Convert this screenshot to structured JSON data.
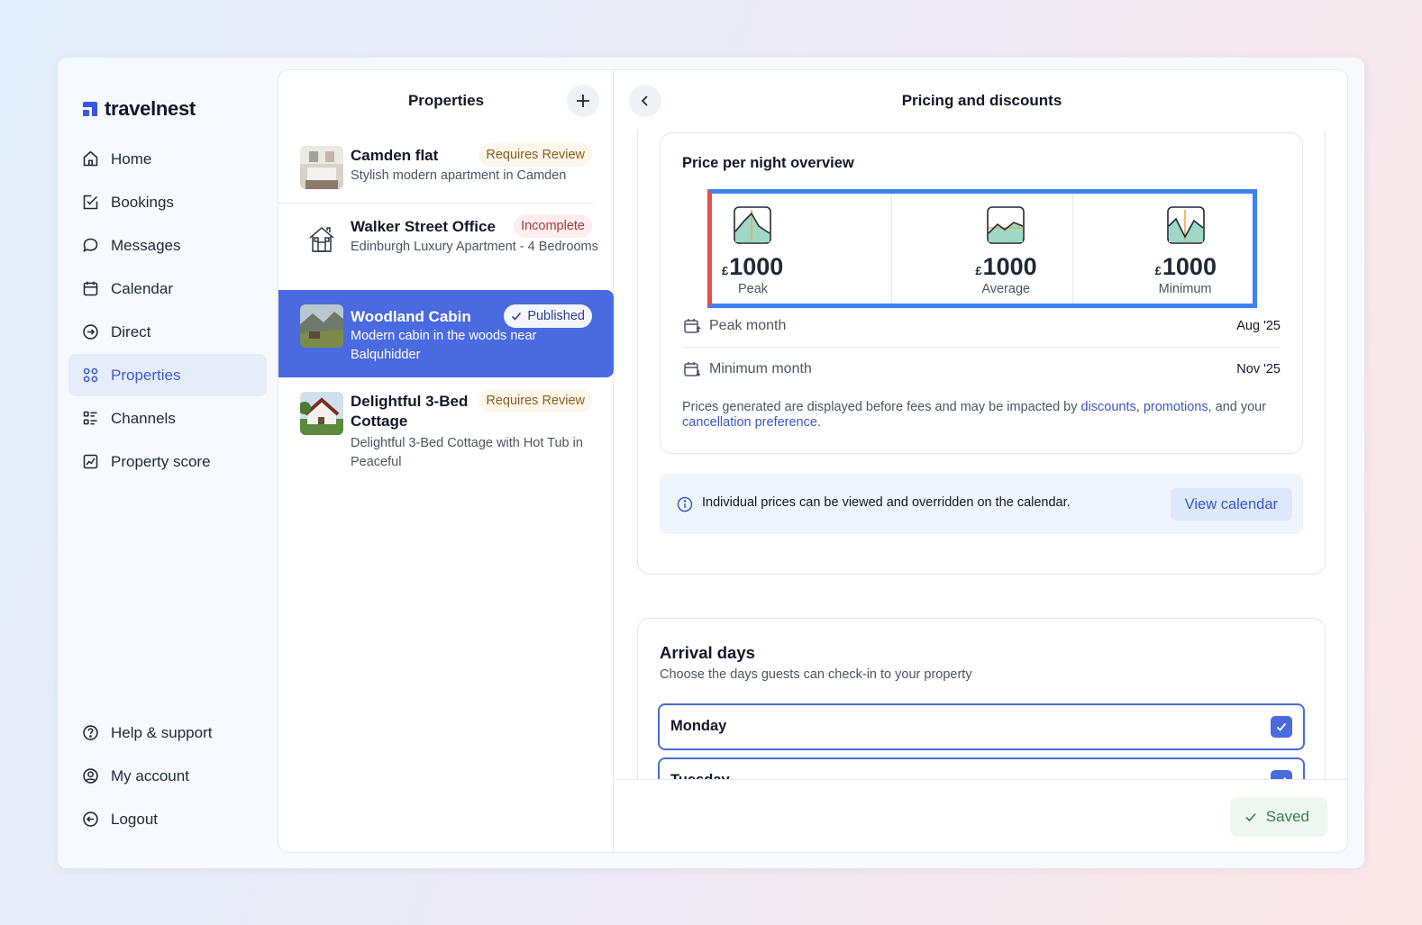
{
  "app": {
    "name": "travelnest"
  },
  "sidebar": {
    "items": [
      {
        "label": "Home",
        "icon": "home-icon"
      },
      {
        "label": "Bookings",
        "icon": "bookings-icon"
      },
      {
        "label": "Messages",
        "icon": "messages-icon"
      },
      {
        "label": "Calendar",
        "icon": "calendar-icon"
      },
      {
        "label": "Direct",
        "icon": "direct-icon"
      },
      {
        "label": "Properties",
        "icon": "properties-icon",
        "active": true
      },
      {
        "label": "Channels",
        "icon": "channels-icon"
      },
      {
        "label": "Property score",
        "icon": "score-icon"
      }
    ],
    "bottom": [
      {
        "label": "Help & support",
        "icon": "help-icon"
      },
      {
        "label": "My account",
        "icon": "account-icon"
      },
      {
        "label": "Logout",
        "icon": "logout-icon"
      }
    ]
  },
  "properties": {
    "title": "Properties",
    "list": [
      {
        "name": "Camden flat",
        "status": "Requires Review",
        "desc": "Stylish modern apartment in Camden"
      },
      {
        "name": "Walker Street Office",
        "status": "Incomplete",
        "desc": "Edinburgh Luxury Apartment - 4 Bedrooms"
      },
      {
        "name": "Woodland Cabin",
        "status": "Published",
        "desc": "Modern cabin in the woods near Balquhidder",
        "active": true
      },
      {
        "name": "Delightful 3-Bed Cottage",
        "status": "Requires Review",
        "desc": "Delightful 3-Bed Cottage with Hot Tub in Peaceful"
      }
    ]
  },
  "detail": {
    "title": "Pricing and discounts",
    "overview": {
      "title": "Price per night overview",
      "currency": "£",
      "stats": [
        {
          "value": "1000",
          "label": "Peak"
        },
        {
          "value": "1000",
          "label": "Average"
        },
        {
          "value": "1000",
          "label": "Minimum"
        }
      ],
      "peak_month_label": "Peak month",
      "peak_month_value": "Aug '25",
      "min_month_label": "Minimum month",
      "min_month_value": "Nov '25",
      "note_prefix": "Prices generated are displayed before fees and may be impacted by ",
      "note_discounts": "discounts",
      "note_comma": ", ",
      "note_promotions": "promotions",
      "note_middle": ", and your ",
      "note_cancellation": "cancellation preference",
      "note_end": "."
    },
    "info": {
      "text": "Individual prices can be viewed and overridden on the calendar.",
      "button": "View calendar"
    },
    "arrival": {
      "title": "Arrival days",
      "subtitle": "Choose the days guests can check-in to your property",
      "days": [
        {
          "label": "Monday",
          "checked": true
        },
        {
          "label": "Tuesday",
          "checked": true
        }
      ]
    },
    "saved_label": "Saved"
  },
  "colors": {
    "accent": "#4a6ae0",
    "link": "#3b55c9",
    "saved_bg": "#eef8f1"
  }
}
